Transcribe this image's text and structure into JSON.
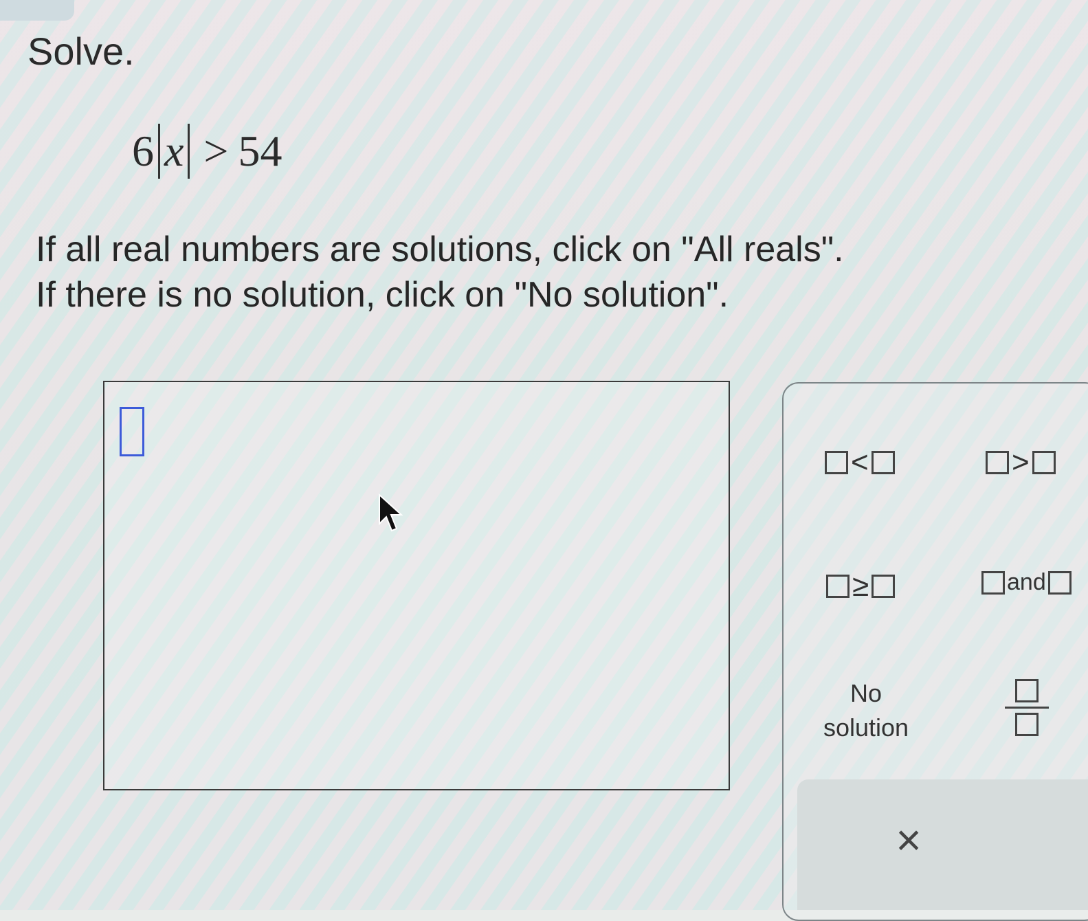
{
  "prompt": {
    "heading": "Solve.",
    "equation": {
      "coefficient": "6",
      "variable": "x",
      "relation": ">",
      "rhs": "54"
    },
    "instructions": [
      "If all real numbers are solutions, click on \"All reals\".",
      "If there is no solution, click on \"No solution\"."
    ]
  },
  "palette": {
    "less_than": "<",
    "greater_than": ">",
    "greater_equal": "≥",
    "and_label": "and",
    "no_solution_line1": "No",
    "no_solution_line2": "solution",
    "clear_symbol": "×"
  },
  "colors": {
    "slot_accent": "#3d5bd9"
  }
}
